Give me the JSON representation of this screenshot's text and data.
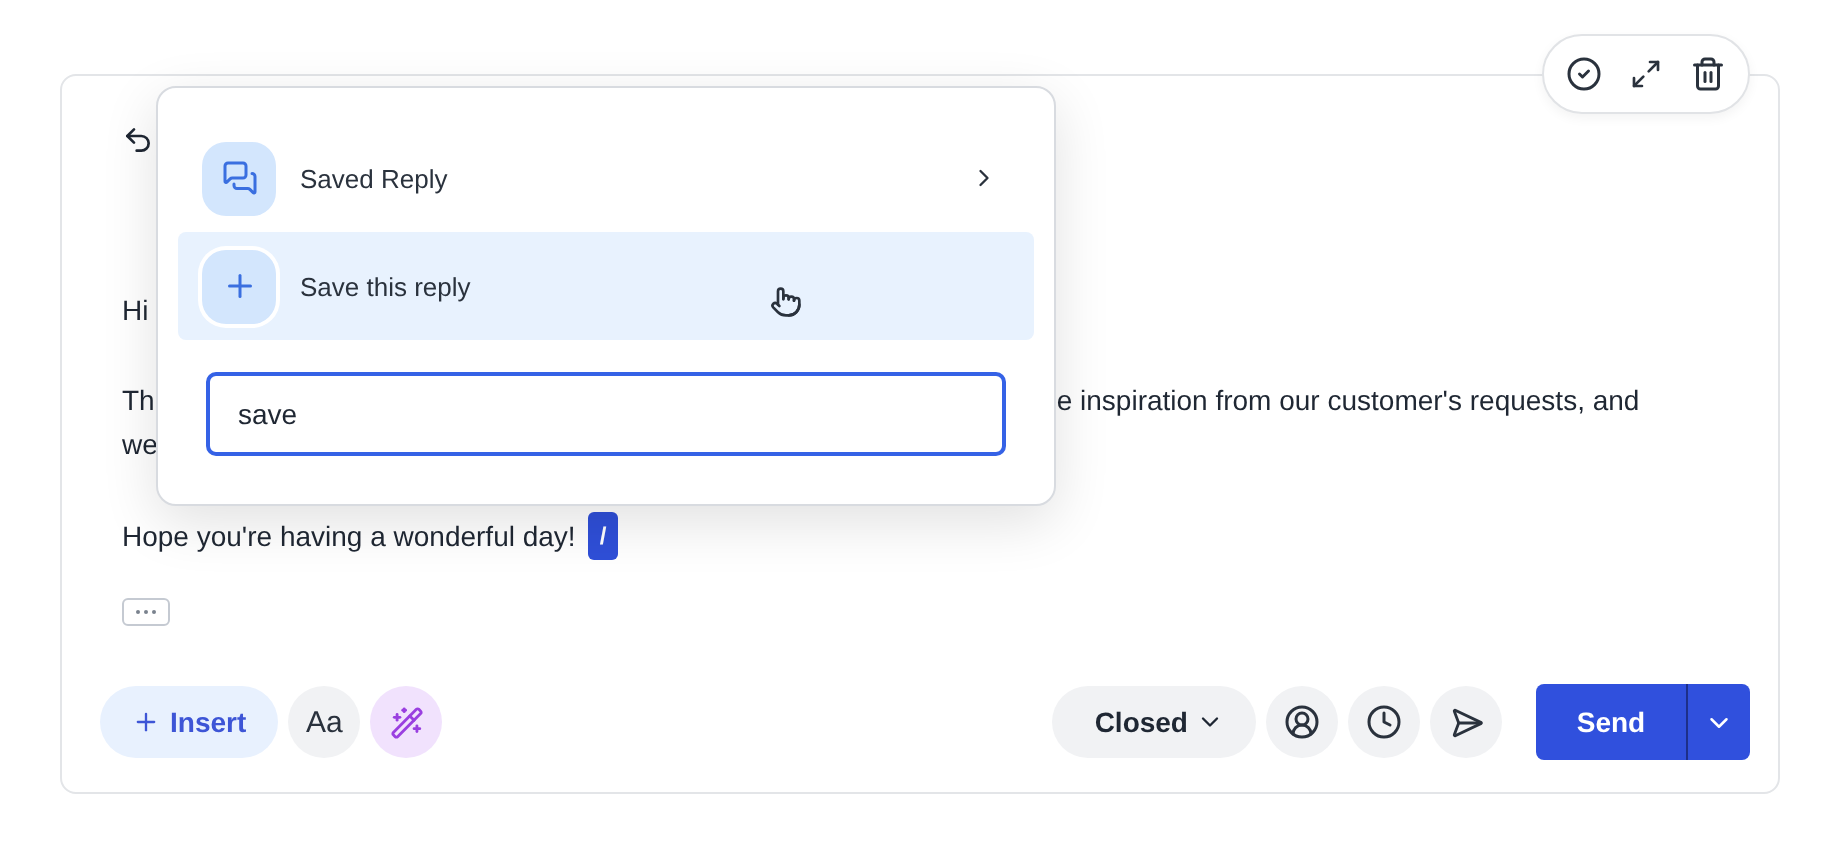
{
  "greeting": "Hi",
  "paragraph": [
    {
      "left": "Th",
      "right": "e inspiration from our customer's requests, and"
    },
    {
      "left": "we"
    }
  ],
  "closing": "Hope you're having a wonderful day!",
  "slash_tag": "/",
  "menu": {
    "items": [
      {
        "kind": "submenu",
        "label": "Saved Reply",
        "selected": false
      },
      {
        "kind": "action",
        "label": "Save this reply",
        "selected": true
      }
    ],
    "search": {
      "value": "save"
    }
  },
  "toolbar": {
    "insert": "Insert",
    "format": "Aa",
    "status": "Closed",
    "send": "Send"
  }
}
